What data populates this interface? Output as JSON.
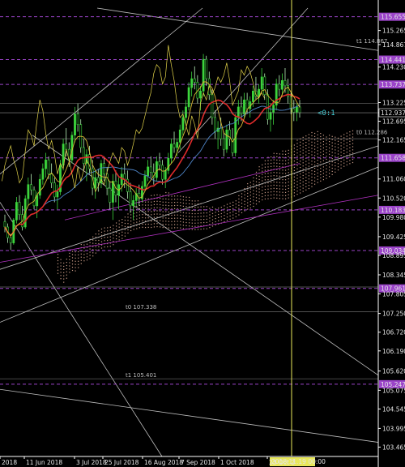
{
  "chart_data": {
    "type": "candlestick",
    "y_ticks": [
      "115.655",
      "115.265",
      "114.867",
      "114.441",
      "114.230",
      "113.737",
      "113.225",
      "112.937",
      "112.695",
      "112.165",
      "111.658",
      "111.060",
      "110.520",
      "110.183",
      "109.980",
      "109.425",
      "109.034",
      "108.895",
      "108.345",
      "107.961",
      "107.805",
      "107.250",
      "106.720",
      "106.190",
      "105.620",
      "105.247",
      "105.075",
      "104.545",
      "103.995",
      "103.465"
    ],
    "ylim": [
      103.2,
      115.9
    ],
    "x_ticks": [
      "2018",
      "11 Jun 2018",
      "3 Jul 2018",
      "25 Jul 2018",
      "16 Aug 2018",
      "7 Sep 2018",
      "1 Oct 2018",
      "23 Oct 2"
    ],
    "cursor_time": "2018.11.19 00:00",
    "current_price": "112.937",
    "callout": "<0:1",
    "level_lines": [
      {
        "price": 115.655,
        "label": "115.655",
        "color": "#9b44c9"
      },
      {
        "price": 114.441,
        "label": "114.441",
        "color": "#9b44c9"
      },
      {
        "price": 113.737,
        "label": "113.737",
        "color": "#9b44c9"
      },
      {
        "price": 111.658,
        "label": "111.658",
        "color": "#9b44c9"
      },
      {
        "price": 110.183,
        "label": "110.183",
        "color": "#9b44c9"
      },
      {
        "price": 109.034,
        "label": "109.034",
        "color": "#9b44c9"
      },
      {
        "price": 107.961,
        "label": "107.961",
        "color": "#9b44c9"
      },
      {
        "price": 105.247,
        "label": "105.247",
        "color": "#9b44c9"
      }
    ],
    "trendline_labels": [
      {
        "text": "t1 114.867",
        "price": 114.867
      },
      {
        "text": "t0 112.286",
        "price": 112.286
      },
      {
        "text": "t0 107.338",
        "price": 107.338
      },
      {
        "text": "t1 105.401",
        "price": 105.401
      }
    ],
    "ohlc": [
      [
        109.85,
        110.05,
        109.55,
        109.7
      ],
      [
        109.7,
        109.8,
        109.25,
        109.4
      ],
      [
        109.4,
        109.5,
        109.05,
        109.25
      ],
      [
        109.25,
        109.95,
        109.2,
        109.9
      ],
      [
        109.9,
        110.55,
        109.8,
        110.4
      ],
      [
        110.4,
        110.6,
        109.9,
        110.05
      ],
      [
        110.05,
        110.3,
        109.6,
        109.7
      ],
      [
        109.7,
        110.6,
        109.65,
        110.5
      ],
      [
        110.5,
        111.1,
        110.3,
        110.9
      ],
      [
        110.9,
        111.2,
        110.6,
        110.75
      ],
      [
        110.75,
        110.85,
        110.2,
        110.3
      ],
      [
        110.3,
        110.7,
        109.95,
        110.6
      ],
      [
        110.6,
        111.2,
        110.5,
        111.05
      ],
      [
        111.05,
        111.5,
        110.9,
        111.35
      ],
      [
        111.35,
        111.8,
        111.1,
        111.6
      ],
      [
        111.6,
        111.7,
        111.05,
        111.2
      ],
      [
        111.2,
        111.5,
        110.8,
        110.95
      ],
      [
        110.95,
        111.1,
        110.4,
        110.55
      ],
      [
        110.55,
        110.9,
        110.2,
        110.7
      ],
      [
        110.7,
        111.6,
        110.6,
        111.45
      ],
      [
        111.45,
        112.2,
        111.3,
        112.05
      ],
      [
        112.05,
        112.5,
        111.7,
        111.9
      ],
      [
        111.9,
        112.1,
        111.4,
        111.6
      ],
      [
        111.6,
        112.4,
        111.5,
        112.3
      ],
      [
        112.3,
        113.1,
        112.1,
        112.9
      ],
      [
        112.9,
        113.2,
        112.4,
        112.6
      ],
      [
        112.6,
        112.75,
        111.8,
        111.95
      ],
      [
        111.95,
        112.2,
        111.3,
        111.5
      ],
      [
        111.5,
        111.9,
        111.0,
        111.75
      ],
      [
        111.75,
        112.0,
        111.2,
        111.35
      ],
      [
        111.35,
        111.6,
        110.6,
        110.8
      ],
      [
        110.8,
        111.3,
        110.5,
        111.1
      ],
      [
        111.1,
        111.35,
        110.7,
        110.95
      ],
      [
        110.95,
        111.6,
        110.8,
        111.5
      ],
      [
        111.5,
        111.7,
        111.0,
        111.2
      ],
      [
        111.2,
        111.4,
        110.6,
        110.8
      ],
      [
        110.8,
        111.0,
        110.2,
        110.4
      ],
      [
        110.4,
        111.2,
        109.9,
        111.0
      ],
      [
        111.0,
        111.3,
        110.4,
        110.6
      ],
      [
        110.6,
        111.1,
        110.2,
        110.9
      ],
      [
        110.9,
        111.4,
        110.7,
        111.2
      ],
      [
        111.2,
        111.5,
        110.8,
        111.05
      ],
      [
        111.05,
        111.3,
        110.5,
        110.7
      ],
      [
        110.7,
        110.95,
        110.1,
        110.3
      ],
      [
        110.3,
        110.6,
        109.9,
        110.45
      ],
      [
        110.45,
        110.8,
        110.3,
        110.65
      ],
      [
        110.65,
        110.9,
        110.3,
        110.5
      ],
      [
        110.5,
        111.0,
        110.4,
        110.85
      ],
      [
        110.85,
        111.3,
        110.7,
        111.15
      ],
      [
        111.15,
        111.6,
        111.0,
        111.4
      ],
      [
        111.4,
        111.7,
        111.1,
        111.25
      ],
      [
        111.25,
        111.5,
        110.9,
        111.1
      ],
      [
        111.1,
        111.7,
        111.0,
        111.55
      ],
      [
        111.55,
        111.8,
        111.3,
        111.45
      ],
      [
        111.45,
        111.6,
        110.9,
        111.05
      ],
      [
        111.05,
        111.4,
        110.8,
        111.3
      ],
      [
        111.3,
        111.8,
        111.2,
        111.65
      ],
      [
        111.65,
        112.2,
        111.5,
        112.05
      ],
      [
        112.05,
        112.4,
        111.8,
        111.95
      ],
      [
        111.95,
        112.2,
        111.7,
        112.1
      ],
      [
        112.1,
        112.6,
        111.9,
        112.45
      ],
      [
        112.45,
        113.0,
        112.3,
        112.8
      ],
      [
        112.8,
        113.3,
        112.6,
        113.1
      ],
      [
        113.1,
        113.8,
        113.0,
        113.65
      ],
      [
        113.65,
        114.1,
        113.4,
        113.9
      ],
      [
        113.9,
        114.25,
        113.6,
        113.8
      ],
      [
        113.8,
        114.0,
        113.2,
        113.35
      ],
      [
        113.35,
        113.7,
        113.0,
        113.55
      ],
      [
        113.55,
        114.6,
        113.4,
        114.45
      ],
      [
        114.45,
        114.55,
        113.7,
        113.9
      ],
      [
        113.9,
        114.1,
        113.3,
        113.45
      ],
      [
        113.45,
        113.6,
        112.6,
        112.8
      ],
      [
        112.8,
        113.0,
        112.2,
        112.4
      ],
      [
        112.4,
        112.7,
        111.9,
        112.5
      ],
      [
        112.5,
        112.8,
        112.0,
        112.2
      ],
      [
        112.2,
        112.4,
        111.7,
        111.9
      ],
      [
        111.9,
        112.6,
        111.8,
        112.45
      ],
      [
        112.45,
        112.7,
        112.0,
        112.2
      ],
      [
        112.2,
        112.5,
        111.7,
        111.8
      ],
      [
        111.8,
        112.9,
        111.7,
        112.8
      ],
      [
        112.8,
        113.3,
        112.6,
        113.1
      ],
      [
        113.1,
        113.4,
        112.7,
        112.9
      ],
      [
        112.9,
        113.5,
        112.8,
        113.3
      ],
      [
        113.3,
        113.5,
        112.9,
        113.05
      ],
      [
        113.05,
        113.4,
        112.8,
        113.25
      ],
      [
        113.25,
        113.7,
        113.1,
        113.55
      ],
      [
        113.55,
        113.95,
        113.3,
        113.4
      ],
      [
        113.4,
        113.75,
        113.2,
        113.6
      ],
      [
        113.6,
        114.2,
        113.5,
        113.95
      ],
      [
        113.95,
        114.05,
        113.3,
        113.45
      ],
      [
        113.45,
        113.6,
        112.6,
        112.75
      ],
      [
        112.75,
        113.2,
        112.4,
        112.95
      ],
      [
        112.95,
        113.3,
        112.6,
        113.15
      ],
      [
        113.15,
        113.9,
        113.0,
        113.75
      ],
      [
        113.75,
        114.0,
        113.4,
        113.6
      ],
      [
        113.6,
        114.05,
        113.4,
        113.85
      ],
      [
        113.85,
        114.2,
        113.5,
        113.7
      ],
      [
        113.7,
        113.9,
        113.2,
        113.4
      ],
      [
        113.4,
        113.5,
        112.9,
        113.05
      ],
      [
        113.05,
        113.3,
        112.7,
        112.95
      ],
      [
        112.95,
        113.2,
        112.7,
        113.1
      ],
      [
        113.1,
        113.3,
        112.8,
        112.94
      ]
    ],
    "moving_averages": [
      {
        "name": "red",
        "color": "#e02b2b"
      },
      {
        "name": "orange",
        "color": "#ff6a1a"
      },
      {
        "name": "steel",
        "color": "#4f86c9"
      },
      {
        "name": "violet",
        "color": "#8a2fbf"
      }
    ]
  }
}
